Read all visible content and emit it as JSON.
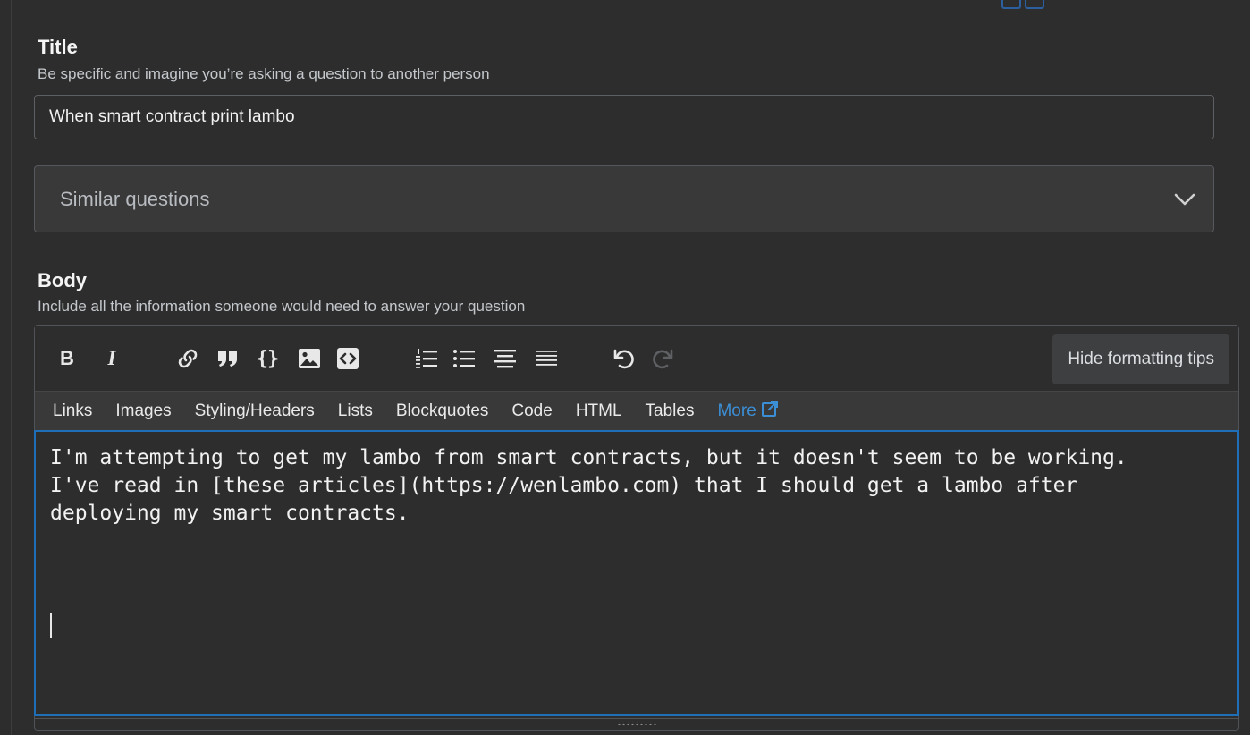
{
  "title_section": {
    "heading": "Title",
    "description": "Be specific and imagine you’re asking a question to another person",
    "input_value": "When smart contract print lambo"
  },
  "similar_questions": {
    "label": "Similar questions",
    "icon": "chevron-down-icon"
  },
  "body_section": {
    "heading": "Body",
    "description": "Include all the information someone would need to answer your question"
  },
  "toolbar": {
    "buttons": [
      {
        "name": "bold-button",
        "icon": "bold-icon"
      },
      {
        "name": "italic-button",
        "icon": "italic-icon"
      },
      {
        "name": "link-button",
        "icon": "link-icon"
      },
      {
        "name": "blockquote-button",
        "icon": "blockquote-icon"
      },
      {
        "name": "code-button",
        "icon": "code-braces-icon"
      },
      {
        "name": "image-button",
        "icon": "image-icon"
      },
      {
        "name": "snippet-button",
        "icon": "snippet-icon"
      },
      {
        "name": "ordered-list-button",
        "icon": "ordered-list-icon"
      },
      {
        "name": "unordered-list-button",
        "icon": "unordered-list-icon"
      },
      {
        "name": "heading-button",
        "icon": "heading-icon"
      },
      {
        "name": "horizontal-rule-button",
        "icon": "horizontal-rule-icon"
      },
      {
        "name": "undo-button",
        "icon": "undo-icon"
      },
      {
        "name": "redo-button",
        "icon": "redo-icon"
      }
    ],
    "bold_glyph": "B",
    "italic_glyph": "I",
    "code_glyph": "{}",
    "hide_tips_label": "Hide formatting tips"
  },
  "formatting_tips": {
    "links": "Links",
    "images": "Images",
    "styling": "Styling/Headers",
    "lists": "Lists",
    "blockquotes": "Blockquotes",
    "code": "Code",
    "html": "HTML",
    "tables": "Tables",
    "more": "More"
  },
  "editor": {
    "content": "I'm attempting to get my lambo from smart contracts, but it doesn't seem to be working.\nI've read in [these articles](https://wenlambo.com) that I should get a lambo after\ndeploying my smart contracts."
  },
  "colors": {
    "background": "#2d2d2d",
    "focus_border": "#1f6fb8",
    "link_accent": "#3b8fd6"
  }
}
